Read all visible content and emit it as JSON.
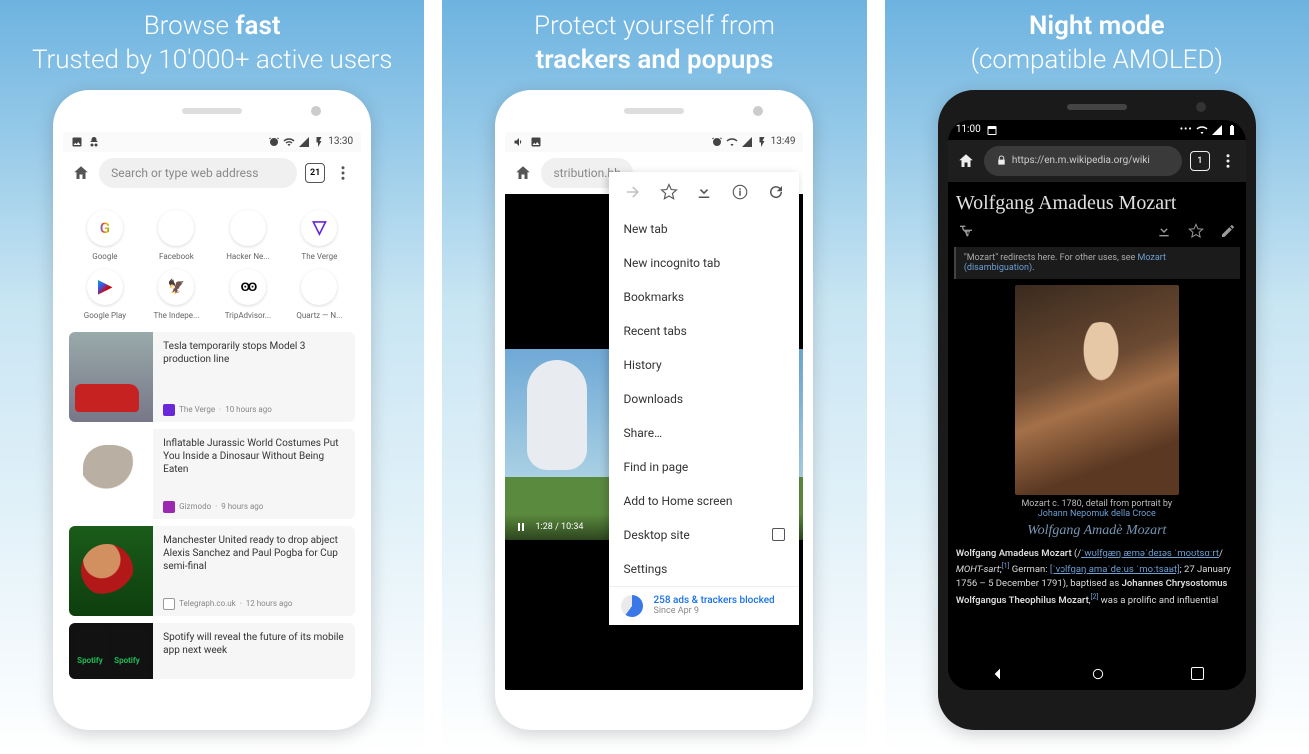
{
  "panel1": {
    "headline_pre": "Browse ",
    "headline_bold": "fast",
    "headline_line2": "Trusted by 10'000+ active users",
    "status_time": "13:30",
    "search_placeholder": "Search or type web address",
    "tab_count": "21",
    "shortcuts": [
      {
        "label": "Google"
      },
      {
        "label": "Facebook"
      },
      {
        "label": "Hacker Ne..."
      },
      {
        "label": "The Verge"
      },
      {
        "label": "Google Play"
      },
      {
        "label": "The Indepe..."
      },
      {
        "label": "TripAdvisor..."
      },
      {
        "label": "Quartz — N..."
      }
    ],
    "feed": [
      {
        "title": "Tesla temporarily stops Model 3 production line",
        "src": "The Verge",
        "ago": "10 hours ago"
      },
      {
        "title": "Inflatable Jurassic World Costumes Put You Inside a Dinosaur Without Being Eaten",
        "src": "Gizmodo",
        "ago": "9 hours ago"
      },
      {
        "title": "Manchester United ready to drop abject Alexis Sanchez and Paul Pogba for Cup semi-final",
        "src": "Telegraph.co.uk",
        "ago": "12 hours ago"
      },
      {
        "title": "Spotify will reveal the future of its mobile app next week",
        "src": "",
        "ago": ""
      }
    ]
  },
  "panel2": {
    "headline_line1": "Protect yourself from",
    "headline_bold": "trackers and popups",
    "status_time": "13:49",
    "url_fragment": "stribution.bb",
    "video_time": "1:28 / 10:34",
    "menu_items": [
      "New tab",
      "New incognito tab",
      "Bookmarks",
      "Recent tabs",
      "History",
      "Downloads",
      "Share…",
      "Find in page",
      "Add to Home screen",
      "Desktop site",
      "Settings"
    ],
    "blocked_text": "258 ads & trackers blocked",
    "blocked_since": "Since Apr 9"
  },
  "panel3": {
    "headline_bold": "Night mode",
    "headline_line2": "(compatible AMOLED)",
    "status_time": "11:00",
    "url": "https://en.m.wikipedia.org/wiki",
    "title": "Wolfgang Amadeus Mozart",
    "redirect_pre": "\"Mozart\" redirects here. For other uses, see ",
    "redirect_link": "Mozart (disambiguation)",
    "caption_pre": "Mozart c. 1780, detail from portrait by",
    "caption_link": "Johann Nepomuk della Croce",
    "para_name": "Wolfgang Amadeus Mozart",
    "para_ipa1": "ˈwʊlfɡæŋ æməˈdeɪəs ˈmoʊtsɑːrt",
    "para_mohtsart": "MOHT-sart",
    "para_sup1": "[1]",
    "para_german": " German: ",
    "para_ipa2": "[ˈvɔlfɡaŋ amaˈdeːus ˈmoːtsaʁt]",
    "para_dates": "; 27 January 1756 – 5 December 1791), baptised as ",
    "para_baptised": "Johannes Chrysostomus Wolfgangus Theophilus Mozart",
    "para_sup2": "[2]",
    "para_tail": " was a prolific and influential"
  }
}
